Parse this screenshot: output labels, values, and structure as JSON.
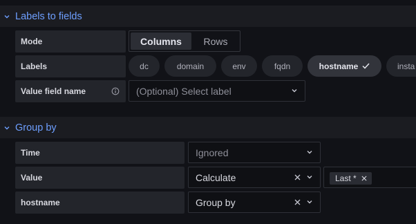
{
  "labels_to_fields": {
    "title": "Labels to fields",
    "rows": {
      "mode": "Mode",
      "labels": "Labels",
      "value_field_name": "Value field name"
    },
    "mode_options": {
      "active": "Columns",
      "inactive": "Rows"
    },
    "label_pills": [
      "dc",
      "domain",
      "env",
      "fqdn",
      "hostname",
      "insta"
    ],
    "selected_pill": "hostname",
    "value_field_select": {
      "placeholder": "(Optional) Select label"
    }
  },
  "group_by": {
    "title": "Group by",
    "rows": [
      {
        "label": "Time",
        "select": "Ignored"
      },
      {
        "label": "Value",
        "select": "Calculate",
        "calc_tag": "Last *"
      },
      {
        "label": "hostname",
        "select": "Group by"
      }
    ]
  },
  "icons": {
    "section_toggle": "chevron-down-icon",
    "info": "info-icon",
    "check": "check-icon",
    "caret": "chevron-down-icon",
    "clear": "close-icon"
  },
  "colors": {
    "background": "#111217",
    "section_title": "#6e9fff",
    "label_cell": "#23252b"
  }
}
